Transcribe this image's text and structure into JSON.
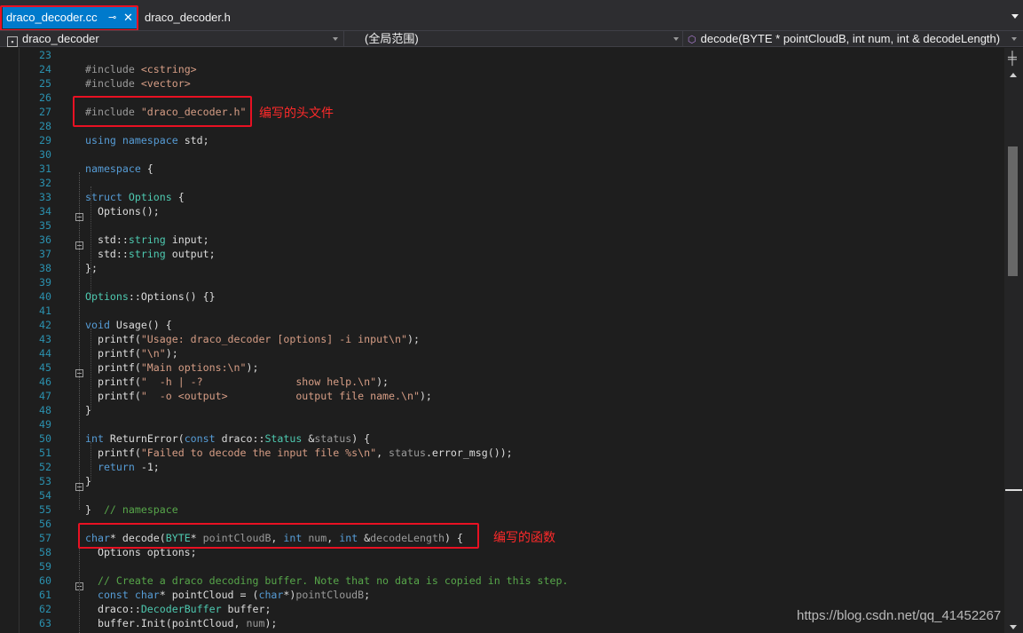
{
  "tabs": {
    "active_label": "draco_decoder.cc",
    "pin_glyph": "⊸",
    "close_glyph": "✕",
    "inactive_label": "draco_decoder.h"
  },
  "navbar": {
    "project": "draco_decoder",
    "scope": "(全局范围)",
    "member": "decode(BYTE * pointCloudB, int num, int & decodeLength)"
  },
  "editor": {
    "lines": [
      {
        "n": "23",
        "html": ""
      },
      {
        "n": "24",
        "html": "<span style='color:#9b9b9b'>#include</span> <span style='color:#d69d85'>&lt;cstring&gt;</span>"
      },
      {
        "n": "25",
        "html": "<span style='color:#9b9b9b'>#include</span> <span style='color:#d69d85'>&lt;vector&gt;</span>"
      },
      {
        "n": "26",
        "html": ""
      },
      {
        "n": "27",
        "html": "<span style='color:#9b9b9b'>#include</span> <span style='color:#d69d85'>\"draco_decoder.h\"</span>"
      },
      {
        "n": "28",
        "html": ""
      },
      {
        "n": "29",
        "html": "<span style='color:#569cd6'>using</span> <span style='color:#569cd6'>namespace</span> std;"
      },
      {
        "n": "30",
        "html": ""
      },
      {
        "n": "31",
        "html": "<span style='color:#569cd6'>namespace</span> {"
      },
      {
        "n": "32",
        "html": ""
      },
      {
        "n": "33",
        "html": "<span style='color:#569cd6'>struct</span> <span style='color:#4ec9b0'>Options</span> {"
      },
      {
        "n": "34",
        "html": "  Options();"
      },
      {
        "n": "35",
        "html": ""
      },
      {
        "n": "36",
        "html": "  std::<span style='color:#4ec9b0'>string</span> input;"
      },
      {
        "n": "37",
        "html": "  std::<span style='color:#4ec9b0'>string</span> output;"
      },
      {
        "n": "38",
        "html": "};"
      },
      {
        "n": "39",
        "html": ""
      },
      {
        "n": "40",
        "html": "<span style='color:#4ec9b0'>Options</span>::Options() {}"
      },
      {
        "n": "41",
        "html": ""
      },
      {
        "n": "42",
        "html": "<span style='color:#569cd6'>void</span> Usage() {"
      },
      {
        "n": "43",
        "html": "  printf(<span style='color:#d69d85'>\"Usage: draco_decoder [options] -i input\\n\"</span>);"
      },
      {
        "n": "44",
        "html": "  printf(<span style='color:#d69d85'>\"\\n\"</span>);"
      },
      {
        "n": "45",
        "html": "  printf(<span style='color:#d69d85'>\"Main options:\\n\"</span>);"
      },
      {
        "n": "46",
        "html": "  printf(<span style='color:#d69d85'>\"  -h | -?               show help.\\n\"</span>);"
      },
      {
        "n": "47",
        "html": "  printf(<span style='color:#d69d85'>\"  -o &lt;output&gt;           output file name.\\n\"</span>);"
      },
      {
        "n": "48",
        "html": "}"
      },
      {
        "n": "49",
        "html": ""
      },
      {
        "n": "50",
        "html": "<span style='color:#569cd6'>int</span> ReturnError(<span style='color:#569cd6'>const</span> draco::<span style='color:#4ec9b0'>Status</span> &amp;<span style='color:#9a9a9a'>status</span>) {"
      },
      {
        "n": "51",
        "html": "  printf(<span style='color:#d69d85'>\"Failed to decode the input file %s\\n\"</span>, <span style='color:#9a9a9a'>status</span>.error_msg());"
      },
      {
        "n": "52",
        "html": "  <span style='color:#569cd6'>return</span> -1;"
      },
      {
        "n": "53",
        "html": "}"
      },
      {
        "n": "54",
        "html": ""
      },
      {
        "n": "55",
        "html": "}  <span style='color:#57a64a'>// namespace</span>"
      },
      {
        "n": "56",
        "html": ""
      },
      {
        "n": "57",
        "html": "<span style='color:#569cd6'>char</span>* decode(<span style='color:#4ec9b0'>BYTE</span>* <span style='color:#9a9a9a'>pointCloudB</span>, <span style='color:#569cd6'>int</span> <span style='color:#9a9a9a'>num</span>, <span style='color:#569cd6'>int</span> &amp;<span style='color:#9a9a9a'>decodeLength</span>) {"
      },
      {
        "n": "58",
        "html": "  Options options;"
      },
      {
        "n": "59",
        "html": ""
      },
      {
        "n": "60",
        "html": "  <span style='color:#57a64a'>// Create a draco decoding buffer. Note that no data is copied in this step.</span>"
      },
      {
        "n": "61",
        "html": "  <span style='color:#569cd6'>const</span> <span style='color:#569cd6'>char</span>* pointCloud = (<span style='color:#569cd6'>char</span>*)<span style='color:#9a9a9a'>pointCloudB</span>;"
      },
      {
        "n": "62",
        "html": "  draco::<span style='color:#4ec9b0'>DecoderBuffer</span> buffer;"
      },
      {
        "n": "63",
        "html": "  buffer.Init(pointCloud, <span style='color:#9a9a9a'>num</span>);"
      }
    ]
  },
  "annotations": {
    "header_note": "编写的头文件",
    "function_note": "编写的函数"
  },
  "watermark": "https://blog.csdn.net/qq_41452267",
  "colors": {
    "tab_active": "#007acc",
    "annotation_red": "#e81123",
    "line_number": "#2b91af",
    "keyword": "#569cd6",
    "type": "#4ec9b0",
    "string": "#d69d85",
    "comment": "#57a64a",
    "preprocessor": "#9b9b9b"
  }
}
